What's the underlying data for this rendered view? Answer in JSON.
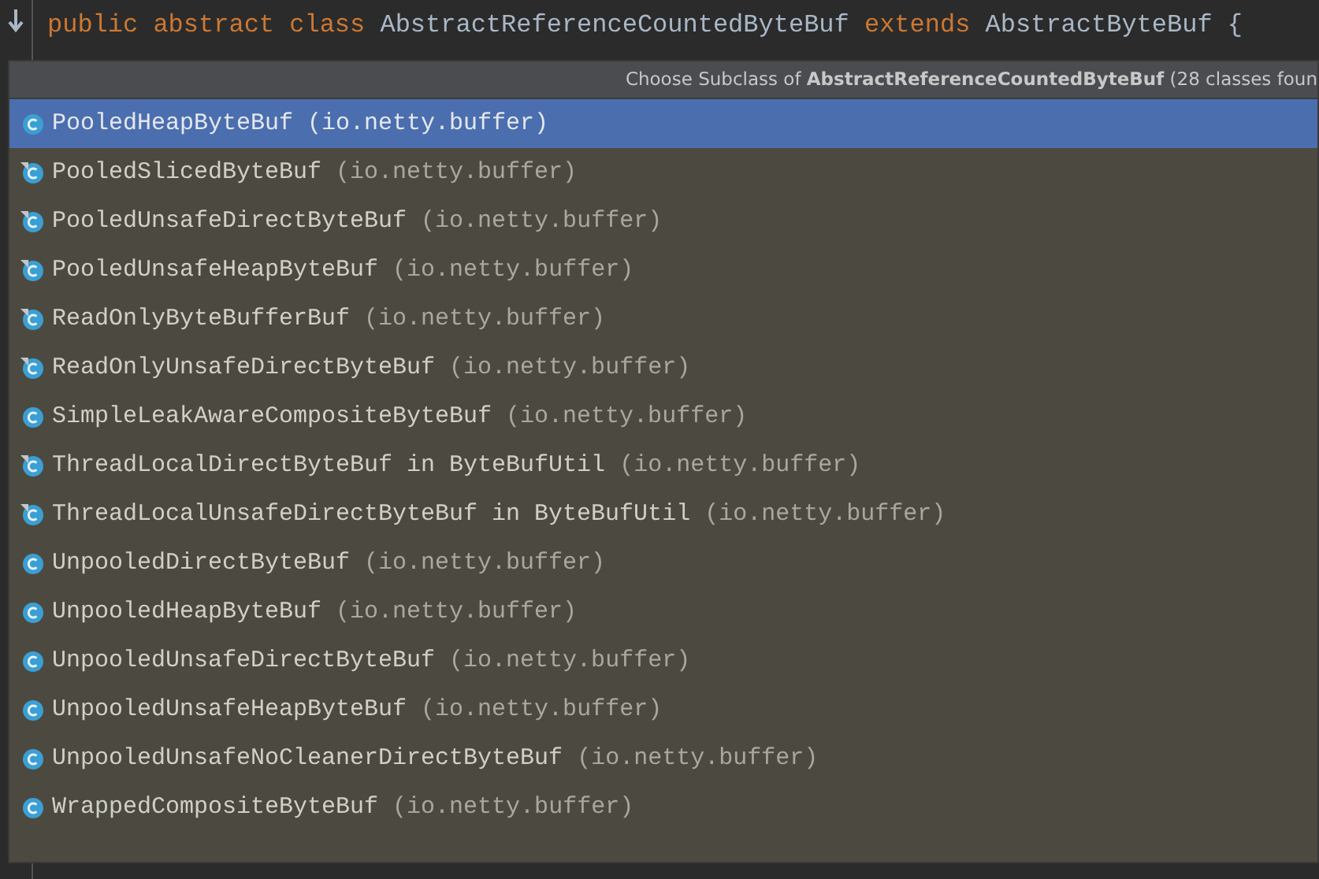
{
  "editor": {
    "code_line": [
      {
        "text": "public",
        "kind": "keyword"
      },
      {
        "text": "abstract",
        "kind": "keyword"
      },
      {
        "text": "class",
        "kind": "keyword"
      },
      {
        "text": "AbstractReferenceCountedByteBuf",
        "kind": "plain"
      },
      {
        "text": "extends",
        "kind": "keyword"
      },
      {
        "text": "AbstractByteBuf",
        "kind": "plain"
      },
      {
        "text": "{",
        "kind": "plain"
      }
    ]
  },
  "popup": {
    "title": "Choose Subclass of **AbstractReferenceCountedByteBuf** (28 classes foun",
    "items": [
      {
        "name": "PooledHeapByteBuf",
        "package": "(io.netty.buffer)",
        "kind": "plain",
        "selected": true
      },
      {
        "name": "PooledSlicedByteBuf",
        "package": "(io.netty.buffer)",
        "kind": "marked",
        "selected": false
      },
      {
        "name": "PooledUnsafeDirectByteBuf",
        "package": "(io.netty.buffer)",
        "kind": "marked",
        "selected": false
      },
      {
        "name": "PooledUnsafeHeapByteBuf",
        "package": "(io.netty.buffer)",
        "kind": "marked",
        "selected": false
      },
      {
        "name": "ReadOnlyByteBufferBuf",
        "package": "(io.netty.buffer)",
        "kind": "marked",
        "selected": false
      },
      {
        "name": "ReadOnlyUnsafeDirectByteBuf",
        "package": "(io.netty.buffer)",
        "kind": "marked",
        "selected": false
      },
      {
        "name": "SimpleLeakAwareCompositeByteBuf",
        "package": "(io.netty.buffer)",
        "kind": "plain",
        "selected": false
      },
      {
        "name": "ThreadLocalDirectByteBuf in ByteBufUtil",
        "package": "(io.netty.buffer)",
        "kind": "marked",
        "selected": false
      },
      {
        "name": "ThreadLocalUnsafeDirectByteBuf in ByteBufUtil",
        "package": "(io.netty.buffer)",
        "kind": "marked",
        "selected": false
      },
      {
        "name": "UnpooledDirectByteBuf",
        "package": "(io.netty.buffer)",
        "kind": "plain",
        "selected": false
      },
      {
        "name": "UnpooledHeapByteBuf",
        "package": "(io.netty.buffer)",
        "kind": "plain",
        "selected": false
      },
      {
        "name": "UnpooledUnsafeDirectByteBuf",
        "package": "(io.netty.buffer)",
        "kind": "plain",
        "selected": false
      },
      {
        "name": "UnpooledUnsafeHeapByteBuf",
        "package": "(io.netty.buffer)",
        "kind": "plain",
        "selected": false
      },
      {
        "name": "UnpooledUnsafeNoCleanerDirectByteBuf",
        "package": "(io.netty.buffer)",
        "kind": "plain",
        "selected": false
      },
      {
        "name": "WrappedCompositeByteBuf",
        "package": "(io.netty.buffer)",
        "kind": "plain",
        "selected": false
      }
    ]
  }
}
